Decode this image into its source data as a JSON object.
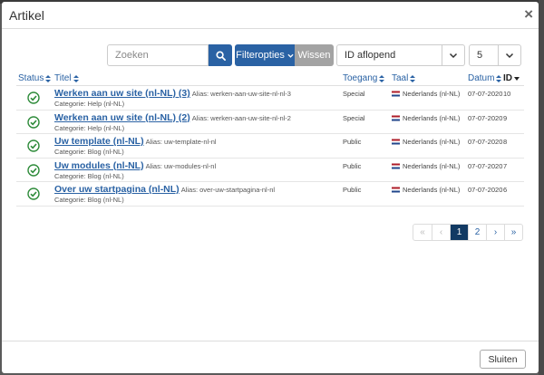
{
  "modal": {
    "title": "Artikel",
    "close_glyph": "×"
  },
  "toolbar": {
    "search_placeholder": "Zoeken",
    "filter_label": "Filteropties",
    "clear_label": "Wissen",
    "order_value": "ID aflopend",
    "limit_value": "5"
  },
  "table": {
    "headers": {
      "status": "Status",
      "title": "Titel",
      "access": "Toegang",
      "language": "Taal",
      "date": "Datum",
      "id": "ID"
    },
    "rows": [
      {
        "title": "Werken aan uw site (nl-NL) (3)",
        "alias": "Alias: werken-aan-uw-site-nl-nl-3",
        "category": "Categorie: Help (nl-NL)",
        "access": "Special",
        "language": "Nederlands (nl-NL)",
        "date": "07-07-2020",
        "id": "10"
      },
      {
        "title": "Werken aan uw site (nl-NL) (2)",
        "alias": "Alias: werken-aan-uw-site-nl-nl-2",
        "category": "Categorie: Help (nl-NL)",
        "access": "Special",
        "language": "Nederlands (nl-NL)",
        "date": "07-07-2020",
        "id": "9"
      },
      {
        "title": "Uw template (nl-NL)",
        "alias": "Alias: uw-template-nl-nl",
        "category": "Categorie: Blog (nl-NL)",
        "access": "Public",
        "language": "Nederlands (nl-NL)",
        "date": "07-07-2020",
        "id": "8"
      },
      {
        "title": "Uw modules (nl-NL)",
        "alias": "Alias: uw-modules-nl-nl",
        "category": "Categorie: Blog (nl-NL)",
        "access": "Public",
        "language": "Nederlands (nl-NL)",
        "date": "07-07-2020",
        "id": "7"
      },
      {
        "title": "Over uw startpagina (nl-NL)",
        "alias": "Alias: over-uw-startpagina-nl-nl",
        "category": "Categorie: Blog (nl-NL)",
        "access": "Public",
        "language": "Nederlands (nl-NL)",
        "date": "07-07-2020",
        "id": "6"
      }
    ]
  },
  "pagination": {
    "first": "«",
    "prev": "‹",
    "pages": [
      "1",
      "2"
    ],
    "next": "›",
    "last": "»",
    "active": "1"
  },
  "footer": {
    "close_label": "Sluiten"
  },
  "colors": {
    "primary": "#2a62a4",
    "published": "#2e8b3a",
    "active_page": "#123a63",
    "secondary": "#a3a3a3"
  }
}
